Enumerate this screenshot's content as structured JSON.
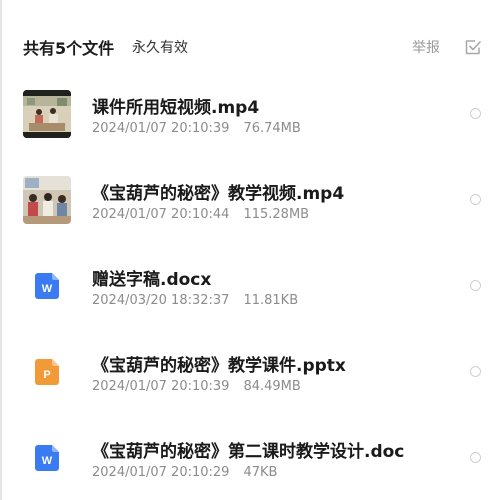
{
  "header": {
    "count_text": "共有5个文件",
    "validity_text": "永久有效",
    "report_label": "举报",
    "select_all_icon": "checkbox-icon"
  },
  "colors": {
    "word_icon": "#3a7bf2",
    "ppt_icon": "#f29a38",
    "radio_border": "#d0d0d0"
  },
  "files": [
    {
      "name": "课件所用短视频.mp4",
      "date": "2024/01/07 20:10:39",
      "size": "76.74MB",
      "icon": "video-thumbnail"
    },
    {
      "name": "《宝葫芦的秘密》教学视频.mp4",
      "date": "2024/01/07 20:10:44",
      "size": "115.28MB",
      "icon": "video-thumbnail"
    },
    {
      "name": "赠送字稿.docx",
      "date": "2024/03/20 18:32:37",
      "size": "11.81KB",
      "icon": "word-doc-icon",
      "icon_letter": "W"
    },
    {
      "name": "《宝葫芦的秘密》教学课件.pptx",
      "date": "2024/01/07 20:10:39",
      "size": "84.49MB",
      "icon": "ppt-doc-icon",
      "icon_letter": "P"
    },
    {
      "name": "《宝葫芦的秘密》第二课时教学设计.doc",
      "date": "2024/01/07 20:10:29",
      "size": "47KB",
      "icon": "word-doc-icon",
      "icon_letter": "W"
    }
  ]
}
